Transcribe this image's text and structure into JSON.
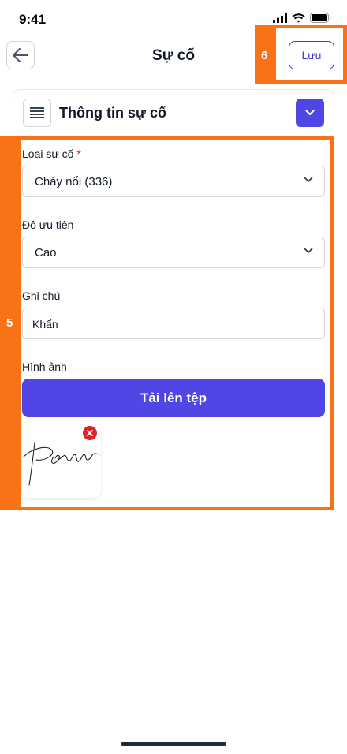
{
  "status_bar": {
    "time": "9:41"
  },
  "header": {
    "title": "Sự cố",
    "save_label": "Lưu"
  },
  "annotations": {
    "save_marker": "6",
    "form_marker": "5"
  },
  "section": {
    "title": "Thông tin sự cố"
  },
  "form": {
    "incident_type": {
      "label": "Loại sự cố",
      "required_mark": "*",
      "value": "Cháy nổi (336)"
    },
    "priority": {
      "label": "Độ ưu tiên",
      "value": "Cao"
    },
    "note": {
      "label": "Ghi chú",
      "value": "Khẩn"
    },
    "images": {
      "label": "Hình ảnh",
      "upload_label": "Tải lên tệp"
    }
  },
  "colors": {
    "accent": "#4f46e5",
    "annotation": "#f97316",
    "danger": "#dc2626"
  }
}
